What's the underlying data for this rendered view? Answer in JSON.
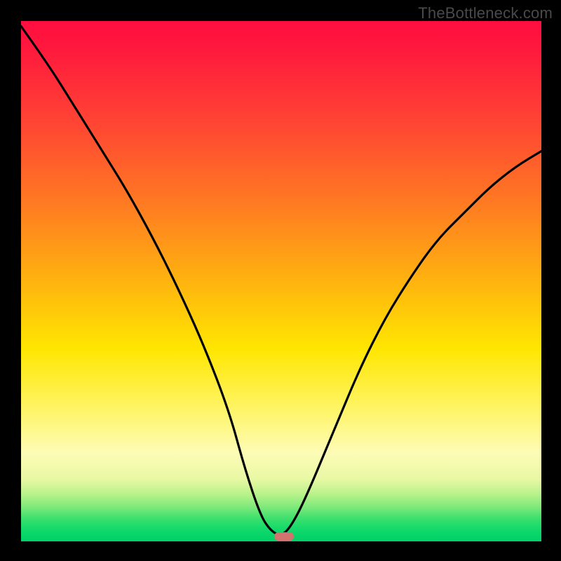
{
  "watermark": "TheBottleneck.com",
  "chart_data": {
    "type": "line",
    "title": "",
    "xlabel": "",
    "ylabel": "",
    "xlim": [
      0,
      100
    ],
    "ylim": [
      0,
      100
    ],
    "grid": false,
    "legend_position": "none",
    "series": [
      {
        "name": "bottleneck-curve",
        "x": [
          0,
          5,
          10,
          15,
          20,
          25,
          30,
          35,
          40,
          43,
          46,
          48,
          50,
          52,
          55,
          60,
          65,
          70,
          75,
          80,
          85,
          90,
          95,
          100
        ],
        "values": [
          99,
          92,
          84,
          76,
          68,
          59,
          49,
          38,
          25,
          14,
          5,
          2,
          1,
          3,
          9,
          21,
          33,
          43,
          51,
          58,
          63,
          68,
          72,
          75
        ]
      }
    ],
    "annotations": [
      {
        "name": "optimal-marker",
        "x": 50.5,
        "y": 1
      }
    ],
    "background": "red-yellow-green vertical gradient"
  }
}
